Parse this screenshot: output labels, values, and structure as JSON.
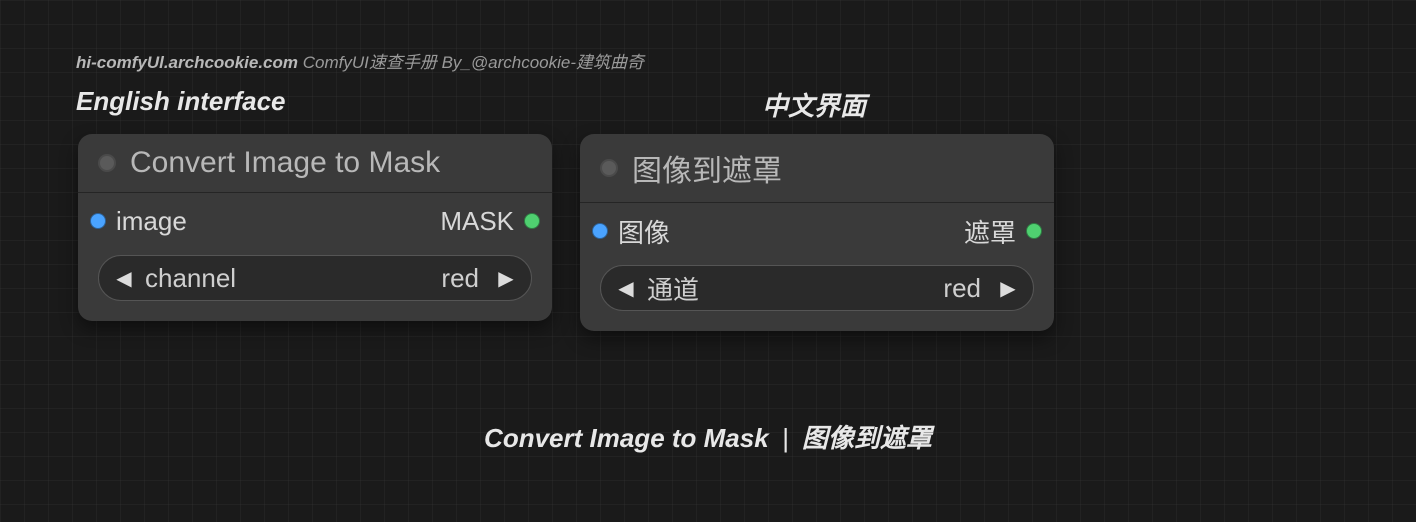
{
  "attribution": {
    "url": "hi-comfyUl.archcookie.com",
    "credit": "ComfyUI速查手册 By_@archcookie-建筑曲奇"
  },
  "columns": {
    "en_label": "English interface",
    "zh_label": "中文界面"
  },
  "node": {
    "en": {
      "title": "Convert Image to Mask",
      "input_label": "image",
      "output_label": "MASK",
      "widget_name": "channel",
      "widget_value": "red"
    },
    "zh": {
      "title": "图像到遮罩",
      "input_label": "图像",
      "output_label": "遮罩",
      "widget_name": "通道",
      "widget_value": "red"
    }
  },
  "footer": {
    "en": "Convert Image to Mask",
    "sep": "|",
    "zh": "图像到遮罩"
  },
  "colors": {
    "input_port": "#4aa3ff",
    "output_port": "#4fd070"
  }
}
